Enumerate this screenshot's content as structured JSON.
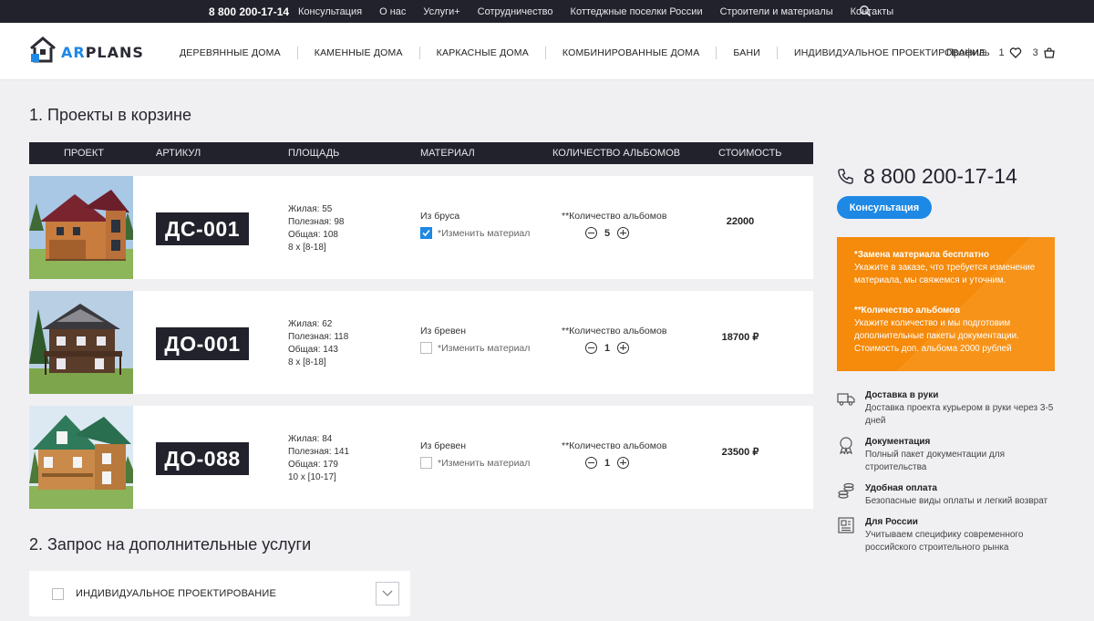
{
  "topbar": {
    "phone": "8 800 200-17-14",
    "nav": [
      "Консультация",
      "О нас",
      "Услуги+",
      "Сотрудничество",
      "Коттеджные поселки России",
      "Строители и материалы",
      "Контакты"
    ]
  },
  "header": {
    "logo_text_a": "AR",
    "logo_text_b": "PLANS",
    "nav": [
      "ДЕРЕВЯННЫЕ ДОМА",
      "КАМЕННЫЕ ДОМА",
      "КАРКАСНЫЕ ДОМА",
      "КОМБИНИРОВАННЫЕ ДОМА",
      "БАНИ",
      "ИНДИВИДУАЛЬНОЕ ПРОЕКТИРОВАНИЕ"
    ],
    "profile_label": "Профиль",
    "favorites_count": "1",
    "cart_count": "3"
  },
  "section1_title": "1. Проекты в корзине",
  "table": {
    "headers": [
      "ПРОЕКТ",
      "АРТИКУЛ",
      "ПЛОЩАДЬ",
      "МАТЕРИАЛ",
      "КОЛИЧЕСТВО АЛЬБОМОВ",
      "СТОИМОСТЬ"
    ],
    "rows": [
      {
        "code": "ДС-001",
        "area": [
          "Жилая: 55",
          "Полезная: 98",
          "Общая: 108",
          "8 х [8-18]"
        ],
        "material": "Из бруса",
        "change_label": "*Изменить материал",
        "change_checked": true,
        "albums_label": "**Количество альбомов",
        "albums": "5",
        "price": "22000"
      },
      {
        "code": "ДО-001",
        "area": [
          "Жилая: 62",
          "Полезная: 118",
          "Общая: 143",
          "8 х [8-18]"
        ],
        "material": "Из бревен",
        "change_label": "*Изменить материал",
        "change_checked": false,
        "albums_label": "**Количество альбомов",
        "albums": "1",
        "price": "18700 ₽"
      },
      {
        "code": "ДО-088",
        "area": [
          "Жилая: 84",
          "Полезная: 141",
          "Общая: 179",
          "10 х [10-17]"
        ],
        "material": "Из бревен",
        "change_label": "*Изменить материал",
        "change_checked": false,
        "albums_label": "**Количество альбомов",
        "albums": "1",
        "price": "23500 ₽"
      }
    ]
  },
  "section2_title": "2. Запрос на дополнительные услуги",
  "services": [
    {
      "label": "ИНДИВИДУАЛЬНОЕ ПРОЕКТИРОВАНИЕ"
    }
  ],
  "sidebar": {
    "phone": "8 800 200-17-14",
    "consult_button": "Консультация",
    "promo": {
      "title1": "*Замена материала бесплатно",
      "text1": "Укажите в заказе, что требуется изменение материала, мы свяжемся и уточним.",
      "title2": "**Количество альбомов",
      "text2": "Укажите количество и мы подготовим дополнительные пакеты документации. Стоимость доп. альбома 2000 рублей"
    },
    "features": [
      {
        "icon": "truck-icon",
        "title": "Доставка в руки",
        "text": "Доставка проекта курьером в руки через 3-5 дней"
      },
      {
        "icon": "award-icon",
        "title": "Документация",
        "text": "Полный пакет документации для строительства"
      },
      {
        "icon": "coins-icon",
        "title": "Удобная оплата",
        "text": "Безопасные виды оплаты и легкий возврат"
      },
      {
        "icon": "newspaper-icon",
        "title": "Для России",
        "text": "Учитываем специфику современного российского строительного рынка"
      }
    ]
  },
  "colors": {
    "dark": "#22222d",
    "accent": "#1e88e5",
    "promo": "#f58a0b",
    "background": "#f0f0f3"
  }
}
